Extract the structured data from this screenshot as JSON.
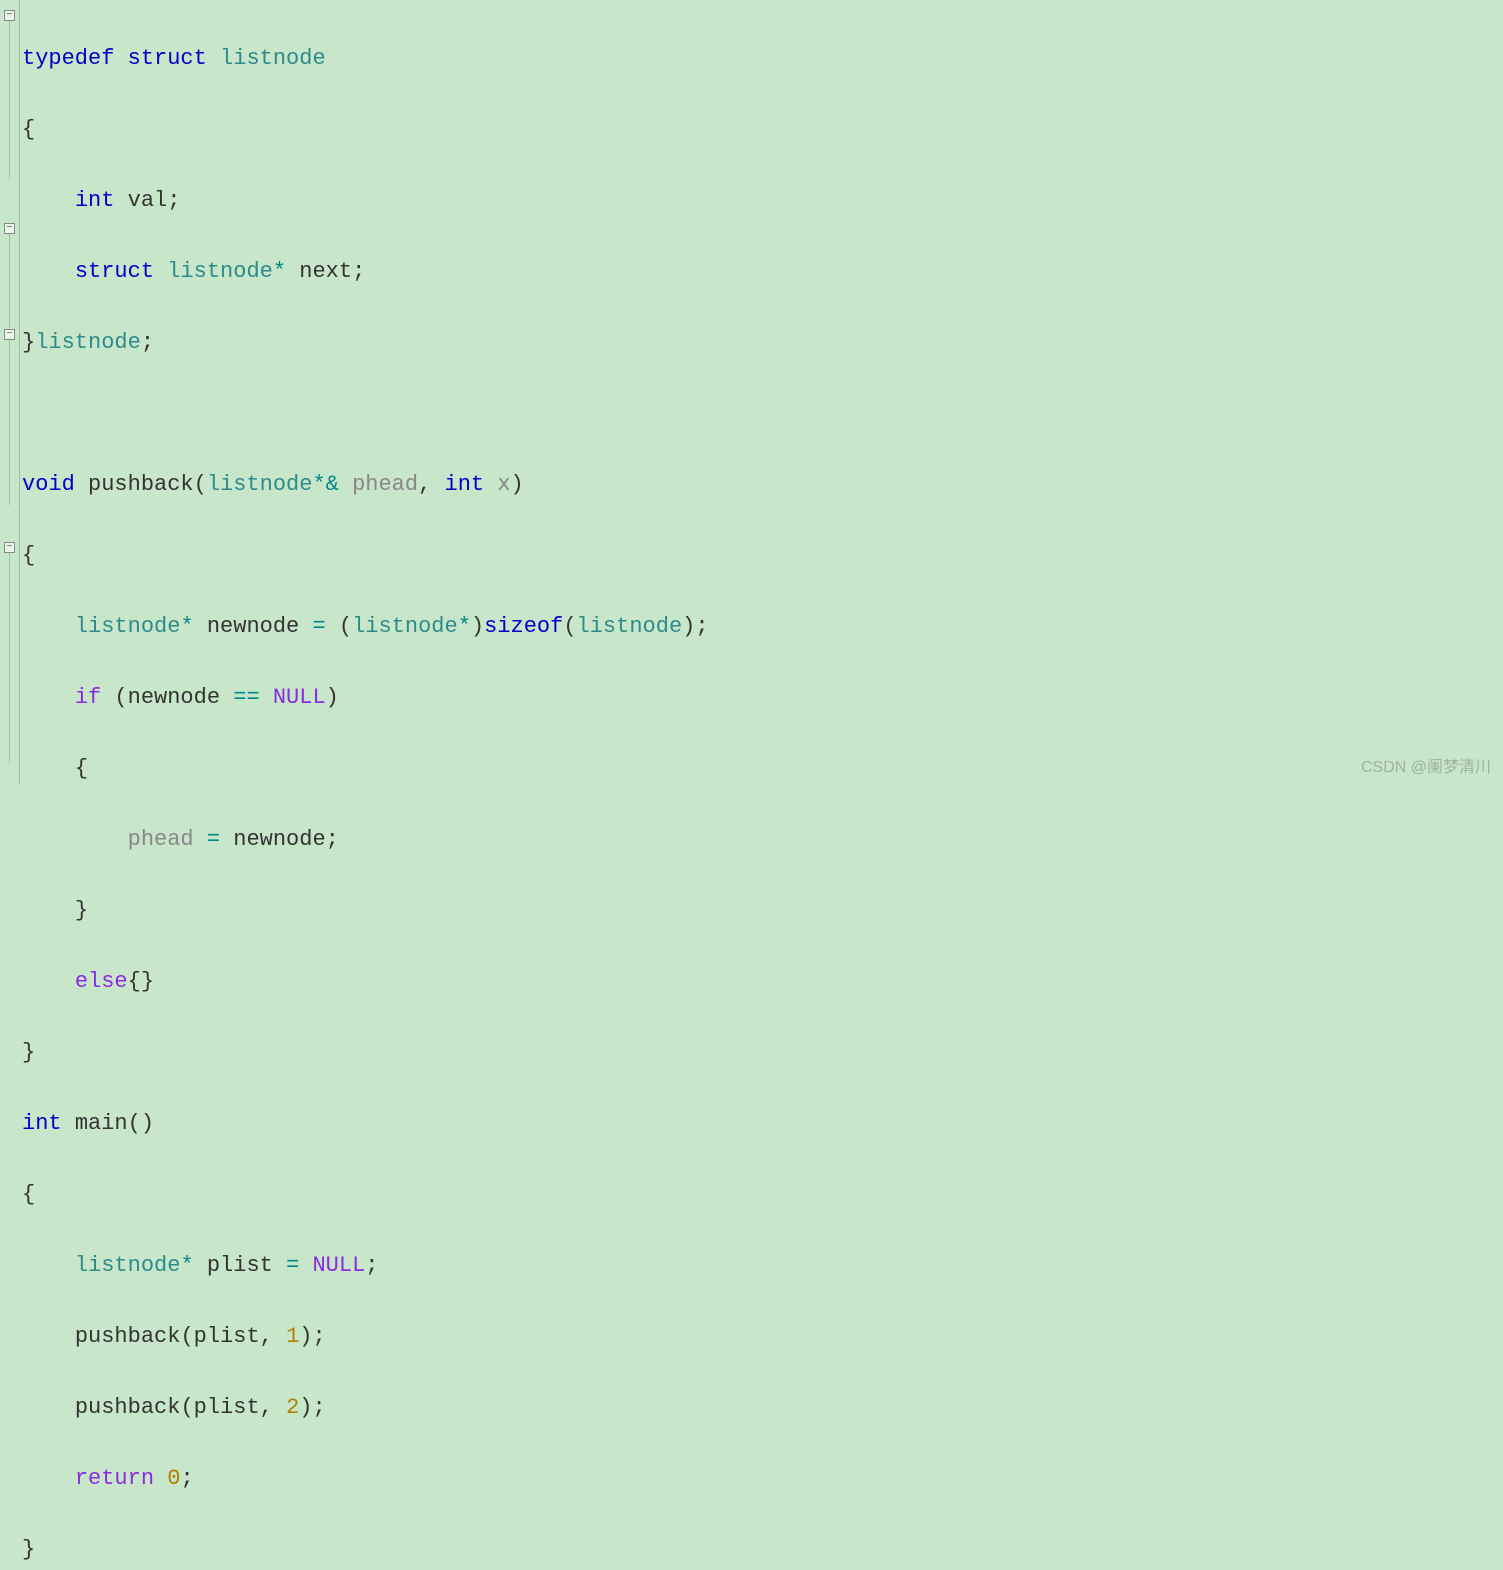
{
  "watermark": "CSDN @阑梦清川",
  "fold_markers": [
    {
      "line": 0,
      "symbol": "−"
    },
    {
      "line": 6,
      "symbol": "−"
    },
    {
      "line": 9,
      "symbol": "−"
    },
    {
      "line": 15,
      "symbol": "−"
    }
  ],
  "code": {
    "line1": {
      "typedef": "typedef",
      "struct": "struct",
      "listnode": "listnode"
    },
    "line2": {
      "brace": "{"
    },
    "line3": {
      "int": "int",
      "ident": "val",
      "semi": ";"
    },
    "line4": {
      "struct": "struct",
      "listnode": "listnode",
      "star": "*",
      "ident": "next",
      "semi": ";"
    },
    "line5": {
      "brace": "}",
      "listnode": "listnode",
      "semi": ";"
    },
    "line7": {
      "void": "void",
      "func": "pushback",
      "lparen": "(",
      "listnode": "listnode",
      "starref": "*&",
      "param": "phead",
      "comma": ",",
      "int": "int",
      "x": "x",
      "rparen": ")"
    },
    "line8": {
      "brace": "{"
    },
    "line9": {
      "listnode1": "listnode",
      "star1": "*",
      "ident": "newnode",
      "eq": "=",
      "lparen": "(",
      "listnode2": "listnode",
      "star2": "*",
      "rparen": ")",
      "sizeof": "sizeof",
      "lparen2": "(",
      "listnode3": "listnode",
      "rparen2": ")",
      "semi": ";"
    },
    "line10": {
      "if": "if",
      "lparen": "(",
      "ident": "newnode",
      "eqeq": "==",
      "null": "NULL",
      "rparen": ")"
    },
    "line11": {
      "brace": "{"
    },
    "line12": {
      "phead": "phead",
      "eq": "=",
      "ident": "newnode",
      "semi": ";"
    },
    "line13": {
      "brace": "}"
    },
    "line14": {
      "else": "else",
      "braces": "{}"
    },
    "line15": {
      "brace": "}"
    },
    "line16": {
      "int": "int",
      "main": "main",
      "parens": "()"
    },
    "line17": {
      "brace": "{"
    },
    "line18": {
      "listnode": "listnode",
      "star": "*",
      "ident": "plist",
      "eq": "=",
      "null": "NULL",
      "semi": ";"
    },
    "line19": {
      "func": "pushback",
      "lparen": "(",
      "ident": "plist",
      "comma": ",",
      "num": "1",
      "rparen": ")",
      "semi": ";"
    },
    "line20": {
      "func": "pushback",
      "lparen": "(",
      "ident": "plist",
      "comma": ",",
      "num": "2",
      "rparen": ")",
      "semi": ";"
    },
    "line21": {
      "return": "return",
      "num": "0",
      "semi": ";"
    },
    "line22": {
      "brace": "}"
    }
  }
}
